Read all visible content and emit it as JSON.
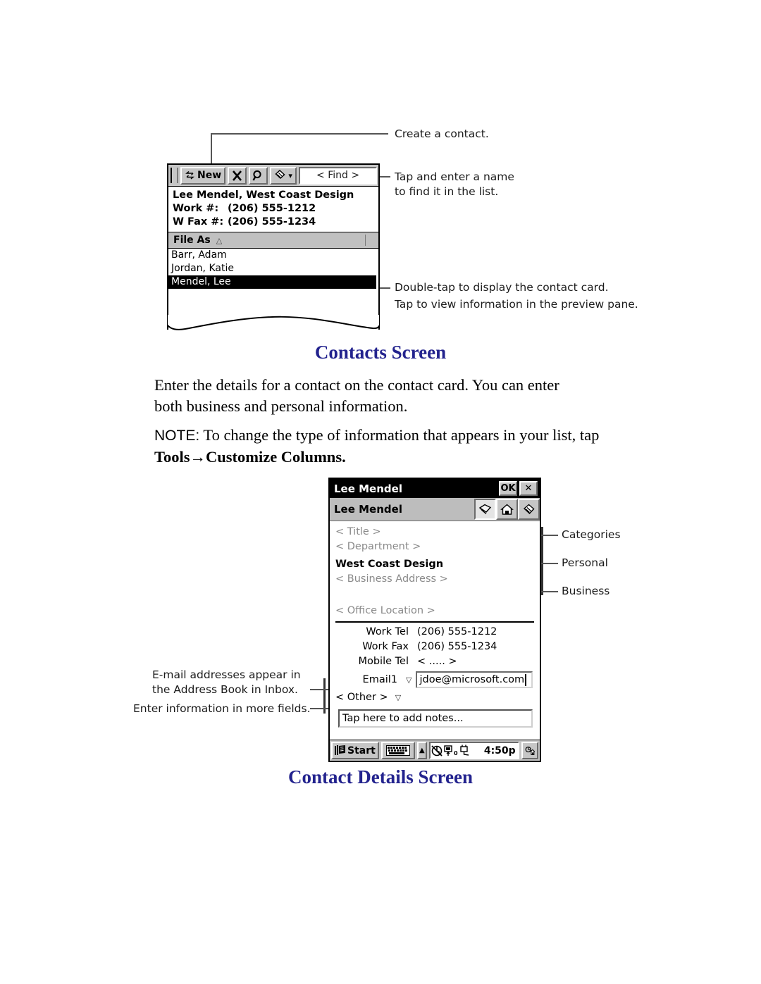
{
  "document": {
    "headings": {
      "contacts_screen": "Contacts Screen",
      "contact_details_screen": "Contact Details Screen"
    },
    "paragraph1": "Enter the details for a contact on the contact card. You can enter both business and personal information.",
    "note_prefix": "NOTE:",
    "note_body": " To change the type of information that appears in your list, tap",
    "note_bold": "Tools→Customize Columns",
    "note_period": "."
  },
  "contacts_screen": {
    "toolbar": {
      "grip": "grip-handle",
      "new_button": "New",
      "new_icon": "arrows-icon",
      "delete_icon": "X",
      "find_icon": "magnifier-icon",
      "tools_icon": "tools-icon",
      "tools_dropdown": "▾",
      "find_placeholder": "< Find >"
    },
    "preview": {
      "name_line": "Lee Mendel, West Coast Design",
      "rows": [
        {
          "label": "Work #:",
          "value": "(206) 555-1212"
        },
        {
          "label": "W Fax #:",
          "value": "(206) 555-1234"
        }
      ]
    },
    "column_header": {
      "label": "File As",
      "sort_arrow": "△"
    },
    "list": [
      {
        "label": "Barr, Adam",
        "selected": false
      },
      {
        "label": "Jordan, Katie",
        "selected": false
      },
      {
        "label": "Mendel, Lee",
        "selected": true
      }
    ],
    "callouts": {
      "create": "Create a contact.",
      "find_l1": "Tap and enter a name",
      "find_l2": "to find it in the list.",
      "list_l1": "Double-tap to display the contact card.",
      "list_l2": "Tap to view information in the preview pane."
    }
  },
  "details_screen": {
    "titlebar": {
      "title": "Lee Mendel",
      "ok_button": "OK",
      "close_button": "✕"
    },
    "subbar": {
      "name": "Lee Mendel",
      "tabs": [
        {
          "name": "business-tab",
          "icon": "cards-icon",
          "active": true
        },
        {
          "name": "personal-tab",
          "icon": "home-icon",
          "active": false
        },
        {
          "name": "categories-tab",
          "icon": "notes-icon",
          "active": false
        }
      ]
    },
    "fields": {
      "title": "< Title >",
      "department": "< Department >",
      "company": "West Coast Design",
      "business_address": "< Business Address >",
      "office_location": "< Office Location >"
    },
    "phone_rows": [
      {
        "label": "Work Tel",
        "value": "(206) 555-1212",
        "dropdown": false,
        "dim": false
      },
      {
        "label": "Work Fax",
        "value": "(206) 555-1234",
        "dropdown": false,
        "dim": false
      },
      {
        "label": "Mobile Tel",
        "value": "< ..... >",
        "dropdown": false,
        "dim": true
      }
    ],
    "email_row": {
      "label": "Email1",
      "dropdown": "▽",
      "value": "jdoe@microsoft.com"
    },
    "other_row": {
      "label": "< Other >",
      "dropdown": "▽"
    },
    "notes_placeholder": "Tap here to add notes...",
    "taskbar": {
      "start_label": "Start",
      "start_icon": "windows-flag-icon",
      "keyboard_icon": "keyboard-icon",
      "keyboard_arrow": "▲",
      "tray_icons": "volume-plug-icons",
      "clock": "4:50p",
      "desktop_icon": "desktop-icon"
    },
    "callouts": {
      "categories": "Categories",
      "personal": "Personal",
      "business": "Business",
      "email_l1": "E-mail addresses appear in",
      "email_l2": "the Address Book in Inbox.",
      "other": "Enter information in more fields."
    }
  },
  "colors": {
    "heading": "#23238e",
    "chrome": "#c6c6c6",
    "subbar": "#bdbdbd",
    "dim_text": "#8a8a8a"
  }
}
